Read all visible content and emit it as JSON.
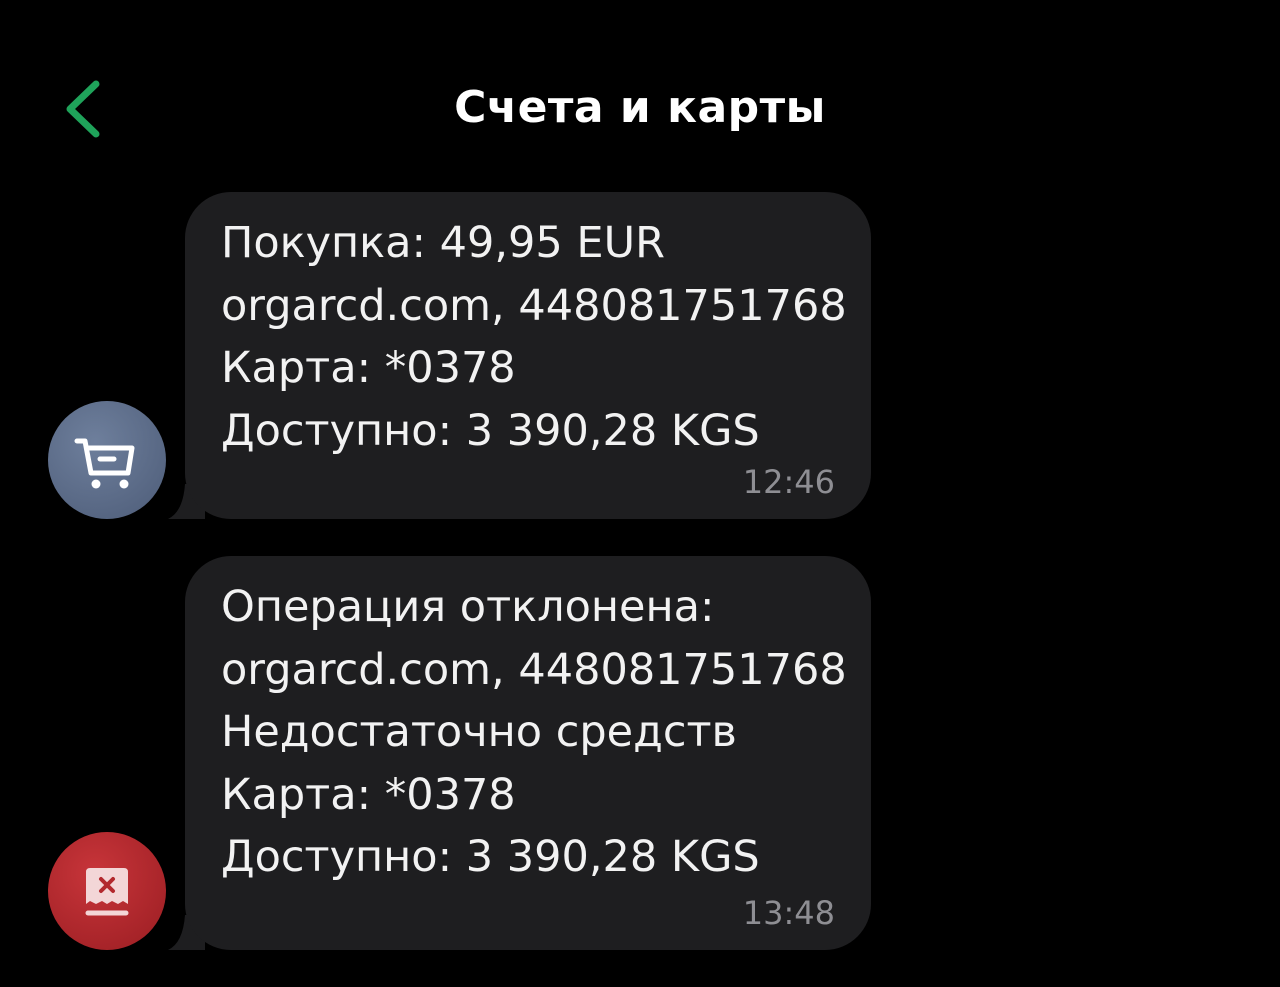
{
  "header": {
    "back_icon": "chevron-left-icon",
    "title": "Счета и карты",
    "accent_color": "#1fa35a"
  },
  "messages": [
    {
      "avatar_icon": "shopping-cart-icon",
      "avatar_color": "#5b6a87",
      "lines": [
        "Покупка: 49,95 EUR",
        "orgarcd.com, 448081751768",
        "Карта: *0378",
        "Доступно: 3 390,28 KGS"
      ],
      "time": "12:46"
    },
    {
      "avatar_icon": "declined-receipt-icon",
      "avatar_color": "#b3282d",
      "lines": [
        "Операция отклонена:",
        "orgarcd.com, 448081751768",
        "Недостаточно средств",
        "Карта: *0378",
        "Доступно: 3 390,28 KGS"
      ],
      "time": "13:48"
    }
  ]
}
